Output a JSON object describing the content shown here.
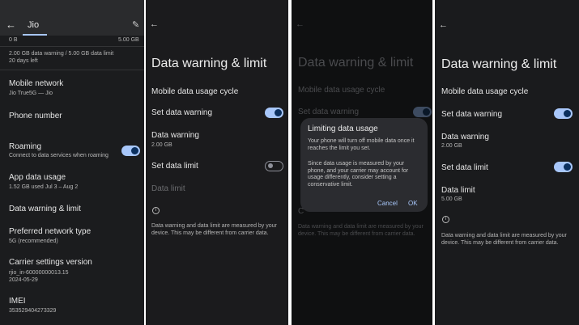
{
  "panel1": {
    "tab_label": "Jio",
    "range_min": "0 B",
    "range_max": "5.00 GB",
    "usage_summary": "2.00 GB data warning / 5.00 GB data limit",
    "days_left": "20 days left",
    "items": [
      {
        "title": "Mobile network",
        "subtitle": "Jio True5G — Jio"
      },
      {
        "title": "Phone number",
        "subtitle": ""
      },
      {
        "title": "Roaming",
        "subtitle": "Connect to data services when roaming",
        "toggle": "on"
      },
      {
        "title": "App data usage",
        "subtitle": "1.52 GB used Jul 3 – Aug 2"
      },
      {
        "title": "Data warning & limit",
        "subtitle": ""
      },
      {
        "title": "Preferred network type",
        "subtitle": "5G (recommended)"
      },
      {
        "title": "Carrier settings version",
        "subtitle": "rjio_in-60000000013.15\n2024-05-29"
      },
      {
        "title": "IMEI",
        "subtitle": "353529404273329"
      }
    ]
  },
  "panel2": {
    "title": "Data warning & limit",
    "cycle_label": "Mobile data usage cycle",
    "set_warning_label": "Set data warning",
    "set_warning_state": "on",
    "warning_label": "Data warning",
    "warning_value": "2.00 GB",
    "set_limit_label": "Set data limit",
    "set_limit_state": "off",
    "limit_label": "Data limit",
    "footnote": "Data warning and data limit are measured by your device. This may be different from carrier data."
  },
  "panel3": {
    "title": "Data warning & limit",
    "cycle_label": "Mobile data usage cycle",
    "set_warning_label": "Set data warning",
    "footnote": "Data warning and data limit are measured by your device. This may be different from carrier data.",
    "dialog": {
      "title": "Limiting data usage",
      "body1": "Your phone will turn off mobile data once it reaches the limit you set.",
      "body2": "Since data usage is measured by your phone, and your carrier may account for usage differently, consider setting a conservative limit.",
      "cancel": "Cancel",
      "ok": "OK"
    }
  },
  "panel4": {
    "title": "Data warning & limit",
    "cycle_label": "Mobile data usage cycle",
    "set_warning_label": "Set data warning",
    "set_warning_state": "on",
    "warning_label": "Data warning",
    "warning_value": "2.00 GB",
    "set_limit_label": "Set data limit",
    "set_limit_state": "on",
    "limit_label": "Data limit",
    "limit_value": "5.00 GB",
    "footnote": "Data warning and data limit are measured by your device. This may be different from carrier data."
  },
  "colors": {
    "accent": "#a8c7fa",
    "background": "#1b1b1d"
  }
}
